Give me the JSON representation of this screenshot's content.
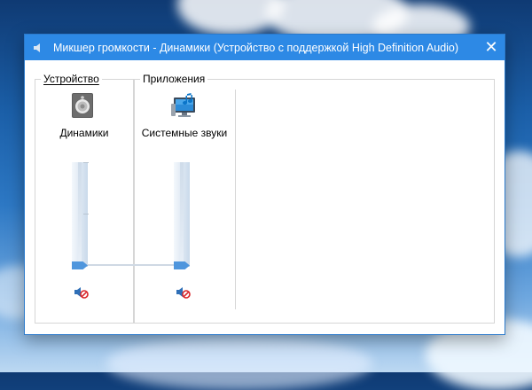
{
  "window": {
    "title": "Микшер громкости - Динамики (Устройство с поддержкой High Definition Audio)",
    "close_glyph": "✕"
  },
  "device": {
    "group_label": "Устройство",
    "name": "Динамики",
    "icon": "speaker-icon",
    "volume_percent": 0,
    "muted": true
  },
  "apps": {
    "group_label": "Приложения",
    "items": [
      {
        "name": "Системные звуки",
        "icon": "system-sounds-icon",
        "volume_percent": 0,
        "muted": true
      }
    ]
  },
  "colors": {
    "titlebar": "#2d89e5",
    "slider_thumb": "#4f96dd",
    "mute_red": "#d9262b"
  }
}
